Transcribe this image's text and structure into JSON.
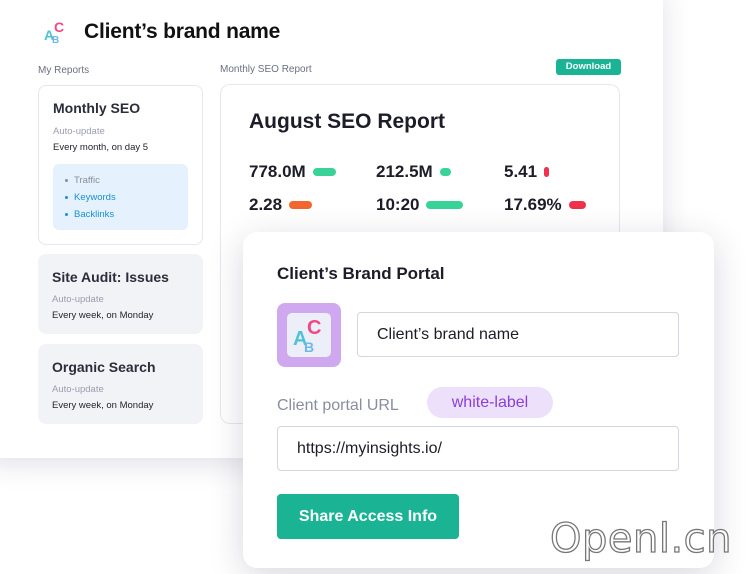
{
  "brand": {
    "name": "Client’s brand name",
    "logo_icon": "abc-logo-icon"
  },
  "my_reports": {
    "label": "My Reports",
    "items": [
      {
        "title": "Monthly SEO",
        "sub": "Auto-update",
        "freq": "Every month, on day 5",
        "sections": [
          "Traffic",
          "Keywords",
          "Backlinks"
        ]
      },
      {
        "title": "Site Audit: Issues",
        "sub": "Auto-update",
        "freq": "Every week, on Monday"
      },
      {
        "title": "Organic Search",
        "sub": "Auto-update",
        "freq": "Every week, on Monday"
      }
    ]
  },
  "report": {
    "section_label": "Monthly SEO Report",
    "download_label": "Download",
    "title": "August SEO Report",
    "metrics": [
      {
        "value": "778.0M",
        "color": "#39d39a"
      },
      {
        "value": "212.5M",
        "color": "#39d39a"
      },
      {
        "value": "5.41",
        "color": "#f0314b"
      },
      {
        "value": "2.28",
        "color": "#f2672f"
      },
      {
        "value": "10:20",
        "color": "#39d39a"
      },
      {
        "value": "17.69%",
        "color": "#f0314b"
      }
    ]
  },
  "portal": {
    "title": "Client’s Brand Portal",
    "brand_name_value": "Client’s brand name",
    "url_label": "Client portal URL",
    "badge": "white-label",
    "url_value": "https://myinsights.io/",
    "share_label": "Share Access Info"
  },
  "colors": {
    "accent": "#1ab394",
    "logo_bg": "#cfa8ef",
    "badge_text": "#8a3fd8",
    "link": "#1a8fd6"
  },
  "watermark": "Openl.cn"
}
